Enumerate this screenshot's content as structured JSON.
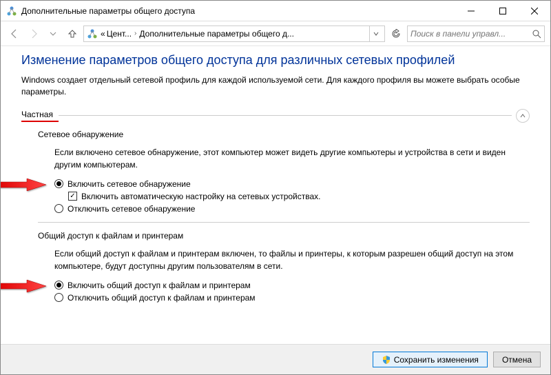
{
  "window": {
    "title": "Дополнительные параметры общего доступа"
  },
  "breadcrumb": {
    "part1_prefix": "«",
    "part1": "Цент...",
    "part2": "Дополнительные параметры общего д..."
  },
  "search": {
    "placeholder": "Поиск в панели управл..."
  },
  "main": {
    "heading": "Изменение параметров общего доступа для различных сетевых профилей",
    "description": "Windows создает отдельный сетевой профиль для каждой используемой сети. Для каждого профиля вы можете выбрать особые параметры."
  },
  "section_private": {
    "title": "Частная"
  },
  "network_discovery": {
    "title": "Сетевое обнаружение",
    "description": "Если включено сетевое обнаружение, этот компьютер может видеть другие компьютеры и устройства в сети и виден другим компьютерам.",
    "opt_on": "Включить сетевое обнаружение",
    "checkbox_label": "Включить автоматическую настройку на сетевых устройствах.",
    "opt_off": "Отключить сетевое обнаружение"
  },
  "file_sharing": {
    "title": "Общий доступ к файлам и принтерам",
    "description": "Если общий доступ к файлам и принтерам включен, то файлы и принтеры, к которым разрешен общий доступ на этом компьютере, будут доступны другим пользователям в сети.",
    "opt_on": "Включить общий доступ к файлам и принтерам",
    "opt_off": "Отключить общий доступ к файлам и принтерам"
  },
  "footer": {
    "save": "Сохранить изменения",
    "cancel": "Отмена"
  }
}
